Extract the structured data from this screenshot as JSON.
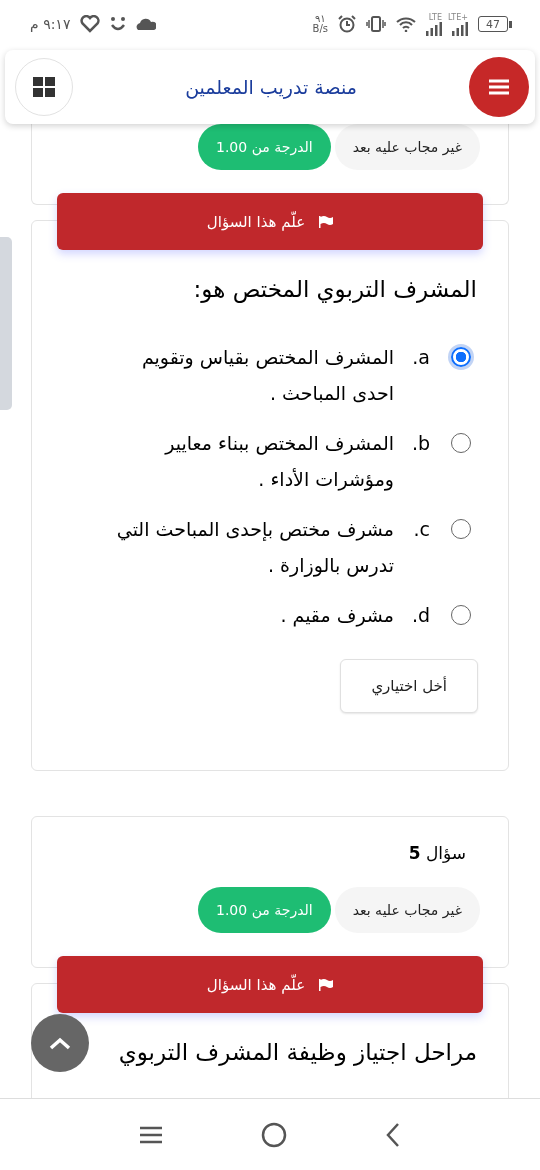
{
  "status_bar": {
    "time": "٩:١٧ م",
    "speed_value": "٩١",
    "speed_unit": "B/s",
    "signal_labels": [
      "LTE+",
      "LTE"
    ],
    "battery": "47"
  },
  "header": {
    "title": "منصة تدريب المعلمين"
  },
  "questions": [
    {
      "state": "غير مجاب عليه بعد",
      "grade": "الدرجة من 1.00",
      "flag_label": "علّم هذا السؤال",
      "text": "المشرف التربوي المختص هو:",
      "options": [
        {
          "letter": "a.",
          "text": "المشرف المختص بقياس وتقويم احدى المباحث .",
          "selected": true
        },
        {
          "letter": "b.",
          "text": "المشرف المختص ببناء معايير ومؤشرات الأداء .",
          "selected": false
        },
        {
          "letter": "c.",
          "text": "مشرف مختص بإحدى المباحث التي تدرس بالوزارة .",
          "selected": false
        },
        {
          "letter": "d.",
          "text": "مشرف مقيم .",
          "selected": false
        }
      ],
      "clear_label": "أخل اختياري"
    },
    {
      "title": "سؤال **5**",
      "state": "غير مجاب عليه بعد",
      "grade": "الدرجة من 1.00",
      "flag_label": "علّم هذا السؤال",
      "text": "مراحل اجتياز وظيفة المشرف التربوي"
    }
  ]
}
